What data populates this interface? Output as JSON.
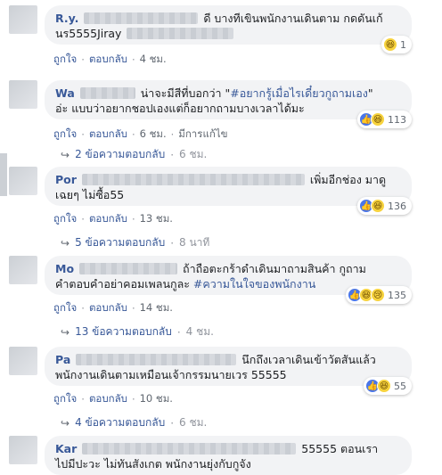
{
  "comments": [
    {
      "name": "R.y.",
      "text_before": "ดี บางทีเขินพนักงานเดินตาม กดดันเก้",
      "text_line2": "นร5555Jiray",
      "text_line2_tail": "",
      "reaction_count": "1",
      "reactions": [
        "haha"
      ],
      "like": "ถูกใจ",
      "reply": "ตอบกลับ",
      "time": "4 ชม."
    },
    {
      "name": "Wa",
      "text_before": "น่าจะมีสีที่บอกว่า \"",
      "hashtag": "#อยากรู้เมื่อไรเดี๋ยวกูถามเอง",
      "text_after": "\"",
      "text_line2": "อ่ะ แบบว่าอยากชอปเองแต่ก็อยากถามบางเวลาได้มะ",
      "reaction_count": "113",
      "reactions": [
        "like",
        "haha"
      ],
      "like": "ถูกใจ",
      "reply": "ตอบกลับ",
      "time": "6 ชม.",
      "edited": "มีการแก้ไข",
      "replies_label": "2 ข้อความตอบกลับ",
      "replies_time": "6 ชม."
    },
    {
      "name": "Por",
      "text_before": "เพิ่มอีกช่อง มาดู",
      "text_line2": "เฉยๆ ไม่ซื้อ55",
      "reaction_count": "136",
      "reactions": [
        "like",
        "haha"
      ],
      "like": "ถูกใจ",
      "reply": "ตอบกลับ",
      "time": "13 ชม.",
      "replies_label": "5 ข้อความตอบกลับ",
      "replies_time": "8 นาที"
    },
    {
      "name": "Mo",
      "text_before": "ถ้าถือตะกร้าดำเดินมาถามสินค้า กูถาม",
      "text_line2": "คำตอบคำอย่าคอมเพลนกูละ ",
      "hashtag": "#ความในใจของพนักงาน",
      "reaction_count": "135",
      "reactions": [
        "like",
        "haha",
        "sad"
      ],
      "like": "ถูกใจ",
      "reply": "ตอบกลับ",
      "time": "14 ชม.",
      "replies_label": "13 ข้อความตอบกลับ",
      "replies_time": "4 ชม."
    },
    {
      "name": "Pa",
      "text_before": "นึกถึงเวลาเดินเข้าวัตสันแล้ว",
      "text_line2": "พนักงานเดินตามเหมือนเจ้ากรรมนายเวร 55555",
      "reaction_count": "55",
      "reactions": [
        "like",
        "haha"
      ],
      "like": "ถูกใจ",
      "reply": "ตอบกลับ",
      "time": "10 ชม.",
      "replies_label": "4 ข้อความตอบกลับ",
      "replies_time": "6 ชม."
    },
    {
      "name": "Kar",
      "text_before": "55555 ตอนเรา",
      "text_line2": "ไปมีปะวะ ไม่ทันสังเกต พนักงานยุ่งกับกูจัง"
    }
  ],
  "icons": {
    "reply_arrow": "reply-arrow-icon",
    "like": "like-reaction-icon",
    "haha": "haha-reaction-icon",
    "sad": "sad-reaction-icon"
  },
  "colors": {
    "link": "#385898",
    "bubble": "#f2f3f5",
    "meta": "#606770"
  }
}
